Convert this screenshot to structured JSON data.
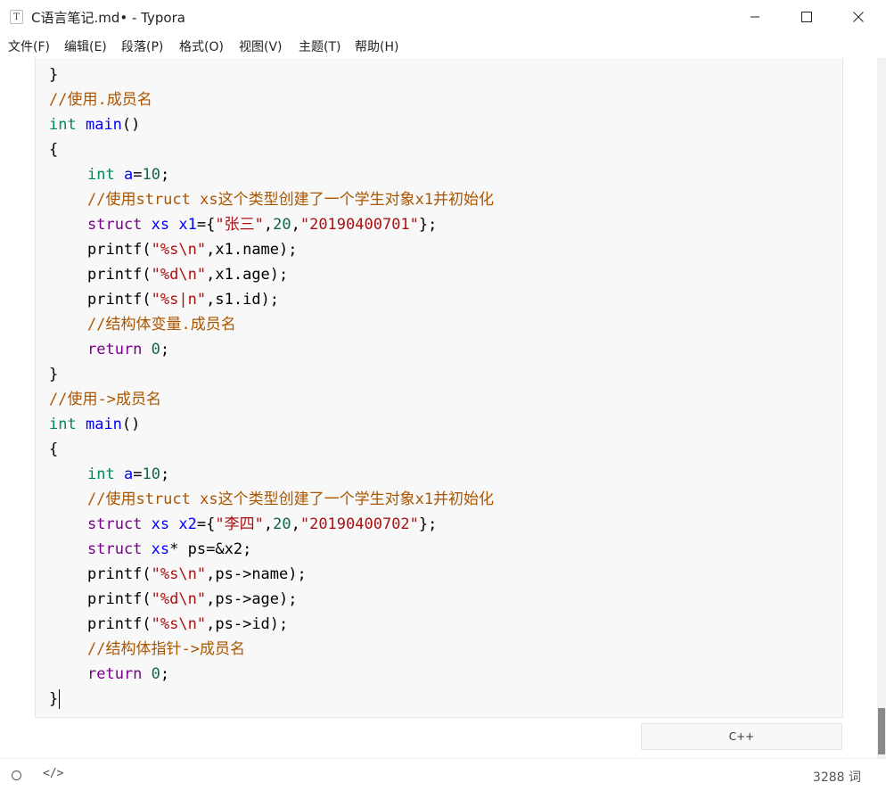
{
  "window": {
    "title": "C语言笔记.md• - Typora",
    "app_icon": "T",
    "controls": [
      "minimize-icon",
      "maximize-icon",
      "close-icon"
    ]
  },
  "menu": {
    "items": [
      "文件(F)",
      "编辑(E)",
      "段落(P)",
      "格式(O)",
      "视图(V)",
      "主题(T)",
      "帮助(H)"
    ]
  },
  "editor": {
    "code_language": "C++",
    "code_lines": [
      "}",
      "//使用.成员名",
      "int main()",
      "{",
      "    int a=10;",
      "    //使用struct xs这个类型创建了一个学生对象x1并初始化",
      "    struct xs x1={\"张三\",20,\"20190400701\"};",
      "    printf(\"%s\\n\",x1.name);",
      "    printf(\"%d\\n\",x1.age);",
      "    printf(\"%s|n\",s1.id);",
      "    //结构体变量.成员名",
      "    return 0;",
      "}",
      "//使用->成员名",
      "int main()",
      "{",
      "    int a=10;",
      "    //使用struct xs这个类型创建了一个学生对象x1并初始化",
      "    struct xs x2={\"李四\",20,\"20190400702\"};",
      "    struct xs* ps=&x2;",
      "    printf(\"%s\\n\",ps->name);",
      "    printf(\"%d\\n\",ps->age);",
      "    printf(\"%s\\n\",ps->id);",
      "    //结构体指针->成员名",
      "    return 0;",
      "}"
    ],
    "syntax_colors": {
      "keyword": "#770088",
      "type": "#008855",
      "definition": "#0000ff",
      "comment": "#aa5500",
      "string": "#aa1111",
      "number": "#116644"
    }
  },
  "statusbar": {
    "outline_icon": "circle-icon",
    "source_icon": "code-icon",
    "source_label": "</>",
    "word_count": "3288 词"
  }
}
